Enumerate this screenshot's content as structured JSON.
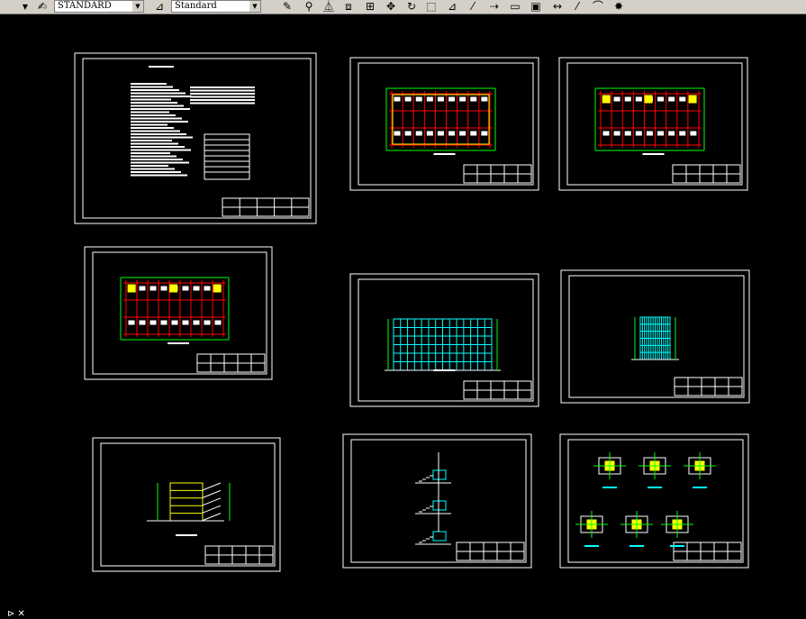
{
  "toolbar": {
    "text_style": "STANDARD",
    "dim_style": "Standard",
    "icons": [
      "dim-style-icon",
      "pencil-icon",
      "measure-icon",
      "mirror-icon",
      "array-icon",
      "move-icon",
      "rotate-icon",
      "scale-icon",
      "stretch-icon",
      "trim-icon",
      "extend-icon",
      "break-icon",
      "chamfer-icon",
      "fillet-icon",
      "explode-icon"
    ]
  },
  "colors": {
    "background": "#000000",
    "frame": "#ffffff",
    "axis": "#ff0000",
    "dimension": "#00ff00",
    "highlight": "#ffff00",
    "elevation": "#00ffff",
    "text": "#ffffff"
  },
  "sheets": [
    {
      "name": "design-notes-sheet",
      "kind": "notes"
    },
    {
      "name": "ground-floor-plan-sheet",
      "kind": "plan"
    },
    {
      "name": "standard-floor-plan-sheet",
      "kind": "plan"
    },
    {
      "name": "roof-plan-sheet",
      "kind": "plan"
    },
    {
      "name": "front-elevation-sheet",
      "kind": "elevation"
    },
    {
      "name": "side-elevation-sheet",
      "kind": "side"
    },
    {
      "name": "section-sheet",
      "kind": "section"
    },
    {
      "name": "stair-detail-sheet",
      "kind": "detail"
    },
    {
      "name": "column-detail-sheet",
      "kind": "columns"
    }
  ]
}
